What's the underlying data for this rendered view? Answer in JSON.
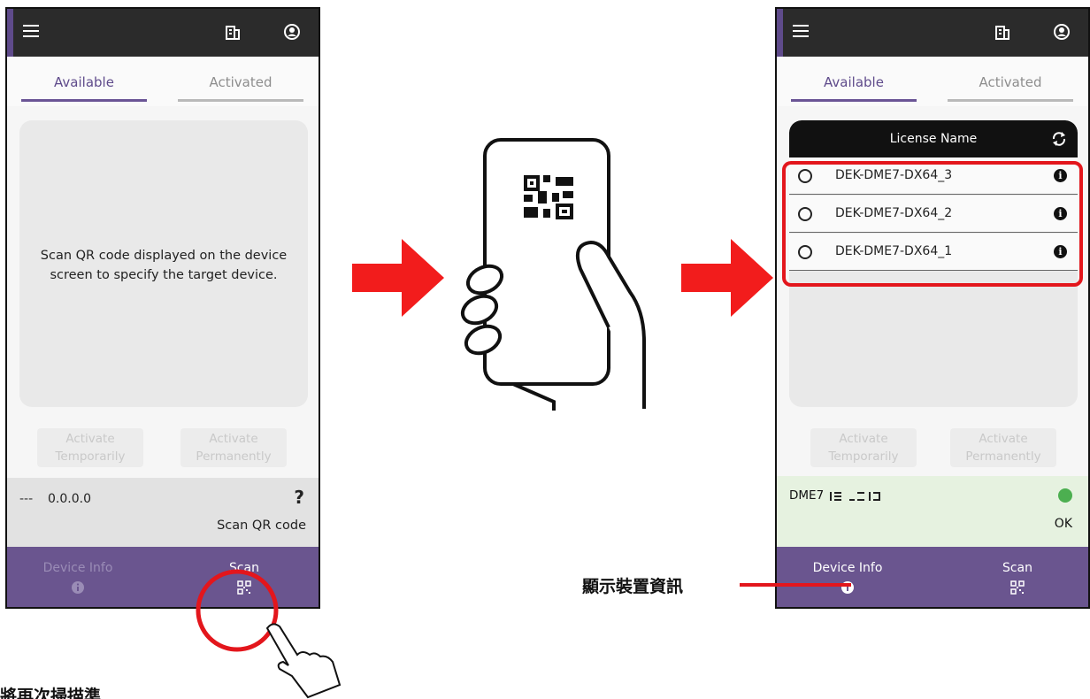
{
  "left_screen": {
    "tabs": [
      "Available",
      "Activated"
    ],
    "message": "Scan QR code displayed on the device screen to specify the target device.",
    "buttons": [
      "Activate Temporarily",
      "Activate Permanently"
    ],
    "status": {
      "dashes": "---",
      "version": "0.0.0.0",
      "question": "?",
      "action": "Scan QR code"
    },
    "nav": [
      {
        "label": "Device Info",
        "icon": "info-icon"
      },
      {
        "label": "Scan",
        "icon": "qr-scan-icon"
      }
    ]
  },
  "right_screen": {
    "tabs": [
      "Available",
      "Activated"
    ],
    "table_header": "License Name",
    "licenses": [
      "DEK-DME7-DX64_3",
      "DEK-DME7-DX64_2",
      "DEK-DME7-DX64_1"
    ],
    "buttons": [
      "Activate Temporarily",
      "Activate Permanently"
    ],
    "status": {
      "device": "DME7",
      "result": "OK"
    },
    "nav": [
      {
        "label": "Device Info",
        "icon": "info-icon"
      },
      {
        "label": "Scan",
        "icon": "qr-scan-icon"
      }
    ]
  },
  "annotations": {
    "device_info_label": "顯示裝置資訊",
    "bottom_label": "將再次掃描準"
  },
  "colors": {
    "accent": "#6a558f",
    "highlight": "#e3161c",
    "topbar": "#2b2b2b",
    "ok": "#4caf50"
  }
}
